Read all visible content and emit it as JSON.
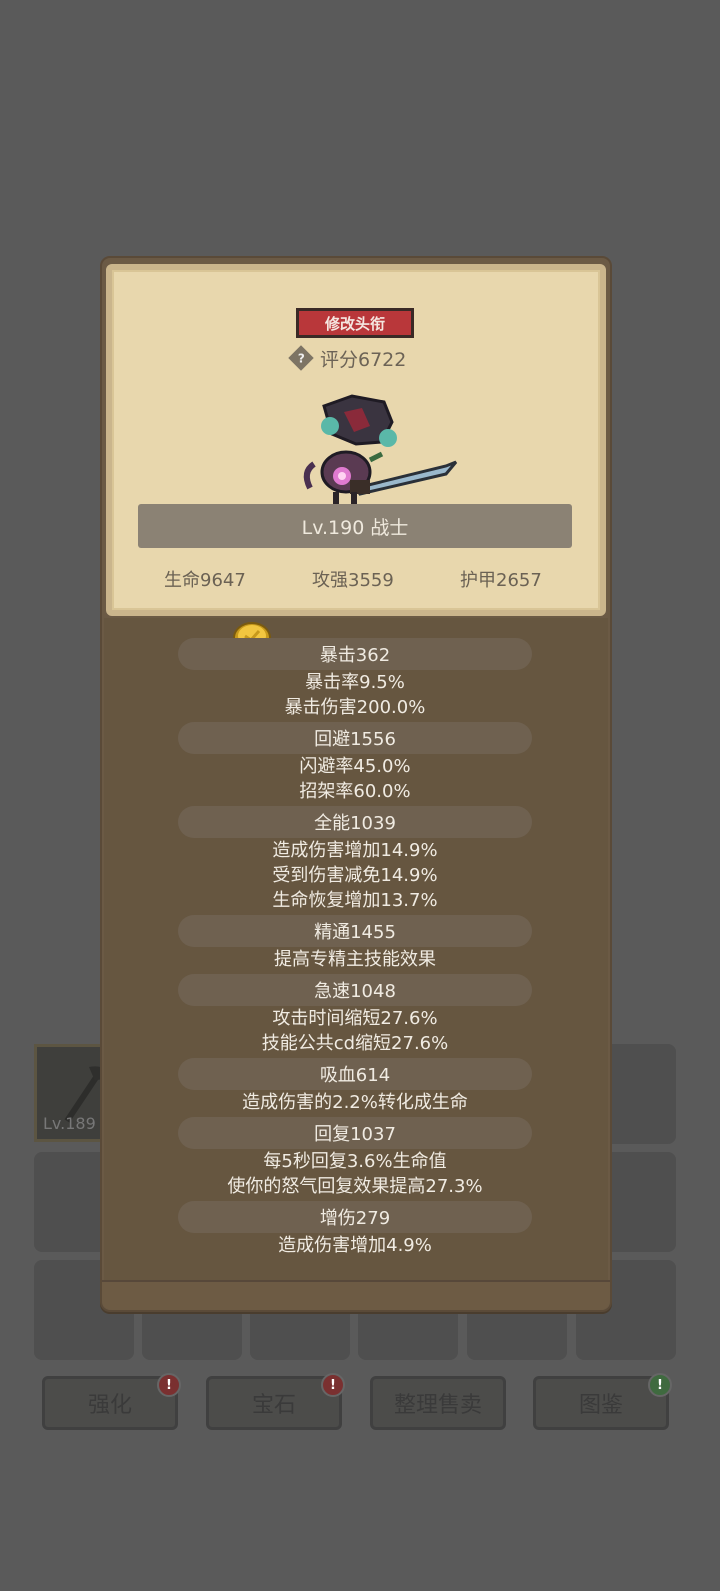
{
  "background": {
    "item": {
      "level_label": "Lv.189"
    },
    "buttons": [
      {
        "label": "强化",
        "badge": "!",
        "badge_color": "red"
      },
      {
        "label": "宝石",
        "badge": "!",
        "badge_color": "red"
      },
      {
        "label": "整理售卖",
        "badge": "",
        "badge_color": ""
      },
      {
        "label": "图鉴",
        "badge": "!",
        "badge_color": "green"
      }
    ]
  },
  "card": {
    "rename_button": "修改头衔",
    "rating_icon": "question-icon",
    "rating": "评分6722",
    "level_class": "Lv.190 战士",
    "base_stats": {
      "hp": "生命9647",
      "atk": "攻强3559",
      "armor": "护甲2657"
    }
  },
  "stats": [
    {
      "head": "暴击362",
      "lines": [
        "暴击率9.5%",
        "暴击伤害200.0%"
      ]
    },
    {
      "head": "回避1556",
      "lines": [
        "闪避率45.0%",
        "招架率60.0%"
      ]
    },
    {
      "head": "全能1039",
      "lines": [
        "造成伤害增加14.9%",
        "受到伤害减免14.9%",
        "生命恢复增加13.7%"
      ]
    },
    {
      "head": "精通1455",
      "lines": [
        "提高专精主技能效果"
      ]
    },
    {
      "head": "急速1048",
      "lines": [
        "攻击时间缩短27.6%",
        "技能公共cd缩短27.6%"
      ]
    },
    {
      "head": "吸血614",
      "lines": [
        "造成伤害的2.2%转化成生命"
      ]
    },
    {
      "head": "回复1037",
      "lines": [
        "每5秒回复3.6%生命值",
        "使你的怒气回复效果提高27.3%"
      ]
    },
    {
      "head": "增伤279",
      "lines": [
        "造成伤害增加4.9%"
      ]
    }
  ],
  "colors": {
    "rename_button": "#b9373a",
    "parchment": "#e8d7ad",
    "modal": "#6b5a45"
  }
}
